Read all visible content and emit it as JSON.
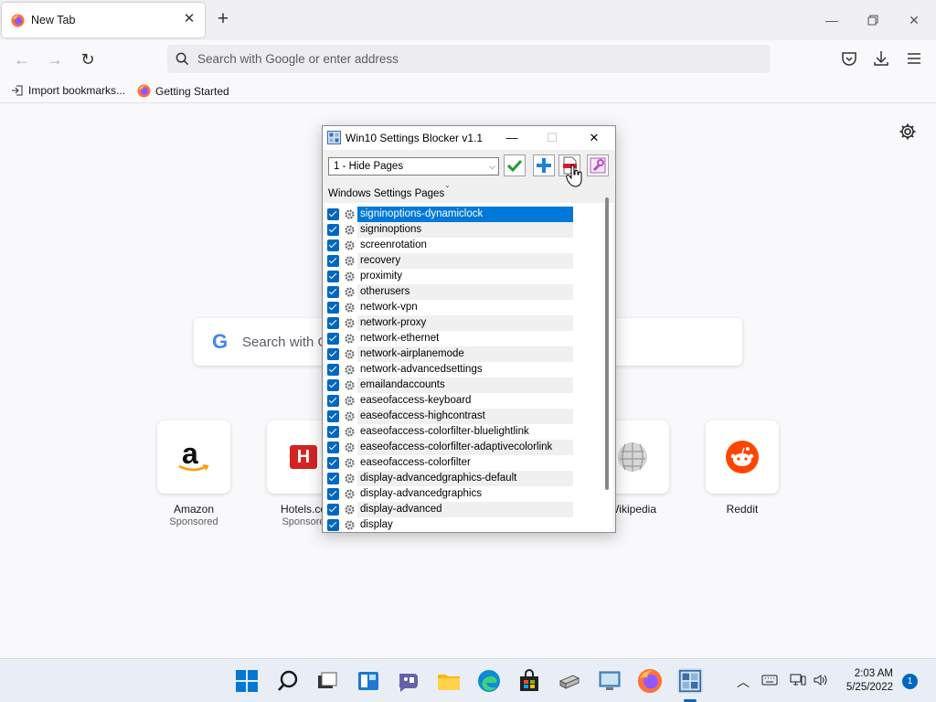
{
  "browser": {
    "tab_title": "New Tab",
    "url_placeholder": "Search with Google or enter address",
    "bookmarks": [
      "Import bookmarks...",
      "Getting Started"
    ]
  },
  "newtab": {
    "search_placeholder": "Search with G",
    "shortcuts": [
      {
        "name": "Amazon",
        "sponsored": "Sponsored"
      },
      {
        "name": "Hotels.co",
        "sponsored": "Sponsore"
      },
      {
        "name": "Wikipedia",
        "sponsored": ""
      },
      {
        "name": "Reddit",
        "sponsored": ""
      }
    ]
  },
  "dialog": {
    "title": "Win10 Settings Blocker v1.1",
    "mode": "1 - Hide Pages",
    "list_label": "Windows Settings Pages",
    "items": [
      {
        "label": "signinoptions-dynamiclock",
        "checked": true,
        "selected": true
      },
      {
        "label": "signinoptions",
        "checked": true
      },
      {
        "label": "screenrotation",
        "checked": true
      },
      {
        "label": "recovery",
        "checked": true
      },
      {
        "label": "proximity",
        "checked": true
      },
      {
        "label": "otherusers",
        "checked": true
      },
      {
        "label": "network-vpn",
        "checked": true
      },
      {
        "label": "network-proxy",
        "checked": true
      },
      {
        "label": "network-ethernet",
        "checked": true
      },
      {
        "label": "network-airplanemode",
        "checked": true
      },
      {
        "label": "network-advancedsettings",
        "checked": true
      },
      {
        "label": "emailandaccounts",
        "checked": true
      },
      {
        "label": "easeofaccess-keyboard",
        "checked": true
      },
      {
        "label": "easeofaccess-highcontrast",
        "checked": true
      },
      {
        "label": "easeofaccess-colorfilter-bluelightlink",
        "checked": true
      },
      {
        "label": "easeofaccess-colorfilter-adaptivecolorlink",
        "checked": true
      },
      {
        "label": "easeofaccess-colorfilter",
        "checked": true
      },
      {
        "label": "display-advancedgraphics-default",
        "checked": true
      },
      {
        "label": "display-advancedgraphics",
        "checked": true
      },
      {
        "label": "display-advanced",
        "checked": true
      },
      {
        "label": "display",
        "checked": true
      }
    ]
  },
  "taskbar": {
    "time": "2:03 AM",
    "date": "5/25/2022",
    "notifications": "1"
  },
  "colors": {
    "accent": "#0067c0",
    "selection": "#0078d7"
  }
}
